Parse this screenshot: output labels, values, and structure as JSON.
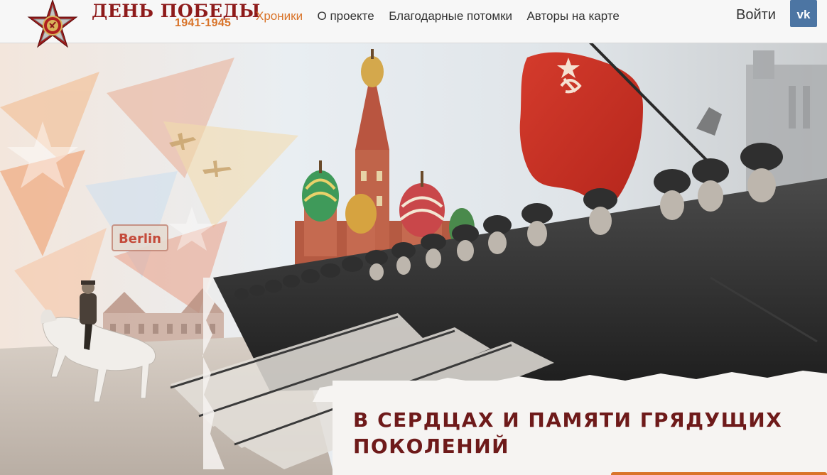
{
  "header": {
    "brand_title": "ДЕНЬ ПОБЕДЫ",
    "brand_years": "1941-1945",
    "nav": [
      {
        "label": "Хроники",
        "active": true
      },
      {
        "label": "О проекте",
        "active": false
      },
      {
        "label": "Благодарные потомки",
        "active": false
      },
      {
        "label": "Авторы на карте",
        "active": false
      }
    ],
    "login_label": "Войти",
    "vk_label": "vk"
  },
  "hero": {
    "sign_text": "Berlin",
    "heading": "В сердцах и памяти грядущих поколений"
  },
  "colors": {
    "accent": "#d9742a",
    "brand_red": "#8e1b1b",
    "heading": "#6e1a1a",
    "vk_blue": "#4c75a3"
  }
}
